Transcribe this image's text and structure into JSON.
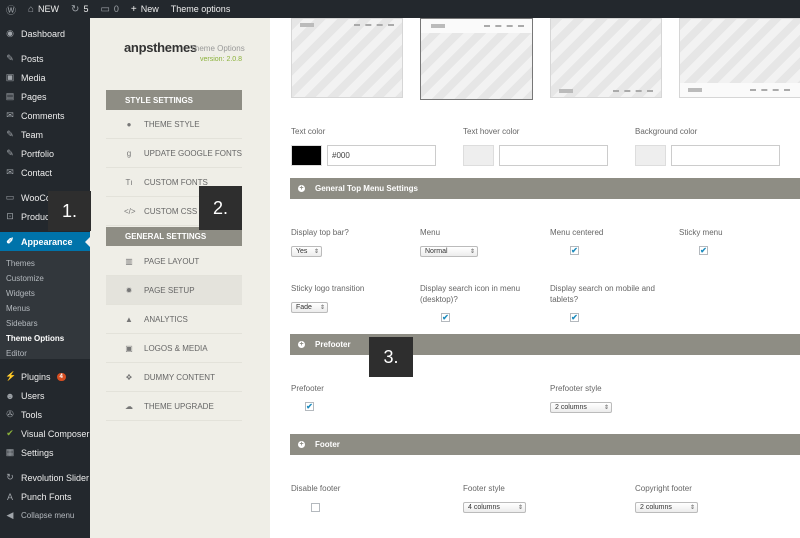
{
  "admin_bar": {
    "site_name": "NEW",
    "updates_count": "5",
    "comments_count": "0",
    "new_label": "New",
    "theme_options_label": "Theme options"
  },
  "wp_menu": {
    "items": [
      {
        "label": "Dashboard",
        "icon": "dashboard-icon",
        "glyph": "◉"
      },
      {
        "label": "Posts",
        "icon": "pin-icon",
        "glyph": "✎"
      },
      {
        "label": "Media",
        "icon": "media-icon",
        "glyph": "▣"
      },
      {
        "label": "Pages",
        "icon": "page-icon",
        "glyph": "▤"
      },
      {
        "label": "Comments",
        "icon": "comment-icon",
        "glyph": "✉"
      },
      {
        "label": "Team",
        "icon": "pin-icon",
        "glyph": "✎"
      },
      {
        "label": "Portfolio",
        "icon": "pin-icon",
        "glyph": "✎"
      },
      {
        "label": "Contact",
        "icon": "mail-icon",
        "glyph": "✉"
      },
      {
        "label": "WooCo",
        "icon": "woo-icon",
        "glyph": "▭"
      },
      {
        "label": "Produc",
        "icon": "cart-icon",
        "glyph": "⊡"
      },
      {
        "label": "Appearance",
        "icon": "brush-icon",
        "glyph": "✐"
      },
      {
        "label": "Plugins",
        "icon": "plugin-icon",
        "glyph": "⚡",
        "badge": "4"
      },
      {
        "label": "Users",
        "icon": "users-icon",
        "glyph": "☻"
      },
      {
        "label": "Tools",
        "icon": "wrench-icon",
        "glyph": "✇"
      },
      {
        "label": "Visual Composer",
        "icon": "vc-icon",
        "glyph": "✔"
      },
      {
        "label": "Settings",
        "icon": "settings-icon",
        "glyph": "▦"
      },
      {
        "label": "Revolution Slider",
        "icon": "refresh-icon",
        "glyph": "↻"
      },
      {
        "label": "Punch Fonts",
        "icon": "font-icon",
        "glyph": "A"
      },
      {
        "label": "Collapse menu",
        "icon": "collapse-icon",
        "glyph": "◀"
      }
    ],
    "appearance_sub": [
      "Themes",
      "Customize",
      "Widgets",
      "Menus",
      "Sidebars",
      "Theme Options",
      "Editor"
    ]
  },
  "markers": [
    "1.",
    "2.",
    "3."
  ],
  "theme_sidebar": {
    "logo": "anpsthemes",
    "title": "Theme Options",
    "version": "version: 2.0.8",
    "style_header": "STYLE SETTINGS",
    "style_items": [
      {
        "label": "THEME STYLE",
        "icon": "drop-icon",
        "glyph": "●"
      },
      {
        "label": "UPDATE GOOGLE FONTS",
        "icon": "google-icon",
        "glyph": "g"
      },
      {
        "label": "CUSTOM FONTS",
        "icon": "font-size-icon",
        "glyph": "Tı"
      },
      {
        "label": "CUSTOM CSS",
        "icon": "code-icon",
        "glyph": "</>"
      }
    ],
    "general_header": "GENERAL SETTINGS",
    "general_items": [
      {
        "label": "PAGE LAYOUT",
        "icon": "layout-icon",
        "glyph": "▥"
      },
      {
        "label": "PAGE SETUP",
        "icon": "gear-icon",
        "glyph": "✹"
      },
      {
        "label": "ANALYTICS",
        "icon": "chart-icon",
        "glyph": "▲"
      },
      {
        "label": "LOGOS & MEDIA",
        "icon": "image-icon",
        "glyph": "▣"
      },
      {
        "label": "DUMMY CONTENT",
        "icon": "dropbox-icon",
        "glyph": "❖"
      },
      {
        "label": "THEME UPGRADE",
        "icon": "cloud-upload-icon",
        "glyph": "☁"
      }
    ]
  },
  "colors": {
    "text_color_label": "Text color",
    "text_color_value": "#000",
    "text_color_swatch": "#000000",
    "hover_label": "Text hover color",
    "hover_value": "",
    "bg_label": "Background color",
    "bg_value": "",
    "empty_swatch": "#eeeeee"
  },
  "top_menu": {
    "title": "General Top Menu Settings",
    "display_top_bar_label": "Display top bar?",
    "display_top_bar_value": "Yes",
    "menu_label": "Menu",
    "menu_value": "Normal",
    "menu_centered_label": "Menu centered",
    "menu_centered_checked": true,
    "sticky_menu_label": "Sticky menu",
    "sticky_menu_checked": true,
    "sticky_logo_label": "Sticky logo transition",
    "sticky_logo_value": "Fade",
    "search_icon_label_1": "Display search icon in menu",
    "search_icon_label_2": "(desktop)?",
    "search_icon_checked": true,
    "search_mobile_label_1": "Display search on mobile and",
    "search_mobile_label_2": "tablets?",
    "search_mobile_checked": true
  },
  "prefooter": {
    "title": "Prefooter",
    "prefooter_label": "Prefooter",
    "prefooter_checked": true,
    "style_label": "Prefooter style",
    "style_value": "2 columns"
  },
  "footer": {
    "title": "Footer",
    "disable_label": "Disable footer",
    "disable_checked": false,
    "style_label": "Footer style",
    "style_value": "4 columns",
    "copyright_label": "Copyright footer",
    "copyright_value": "2 columns"
  },
  "accent": {
    "admin_blue": "#0073aa",
    "section_gray": "#8e8d84",
    "version_green": "#8bb23a"
  }
}
